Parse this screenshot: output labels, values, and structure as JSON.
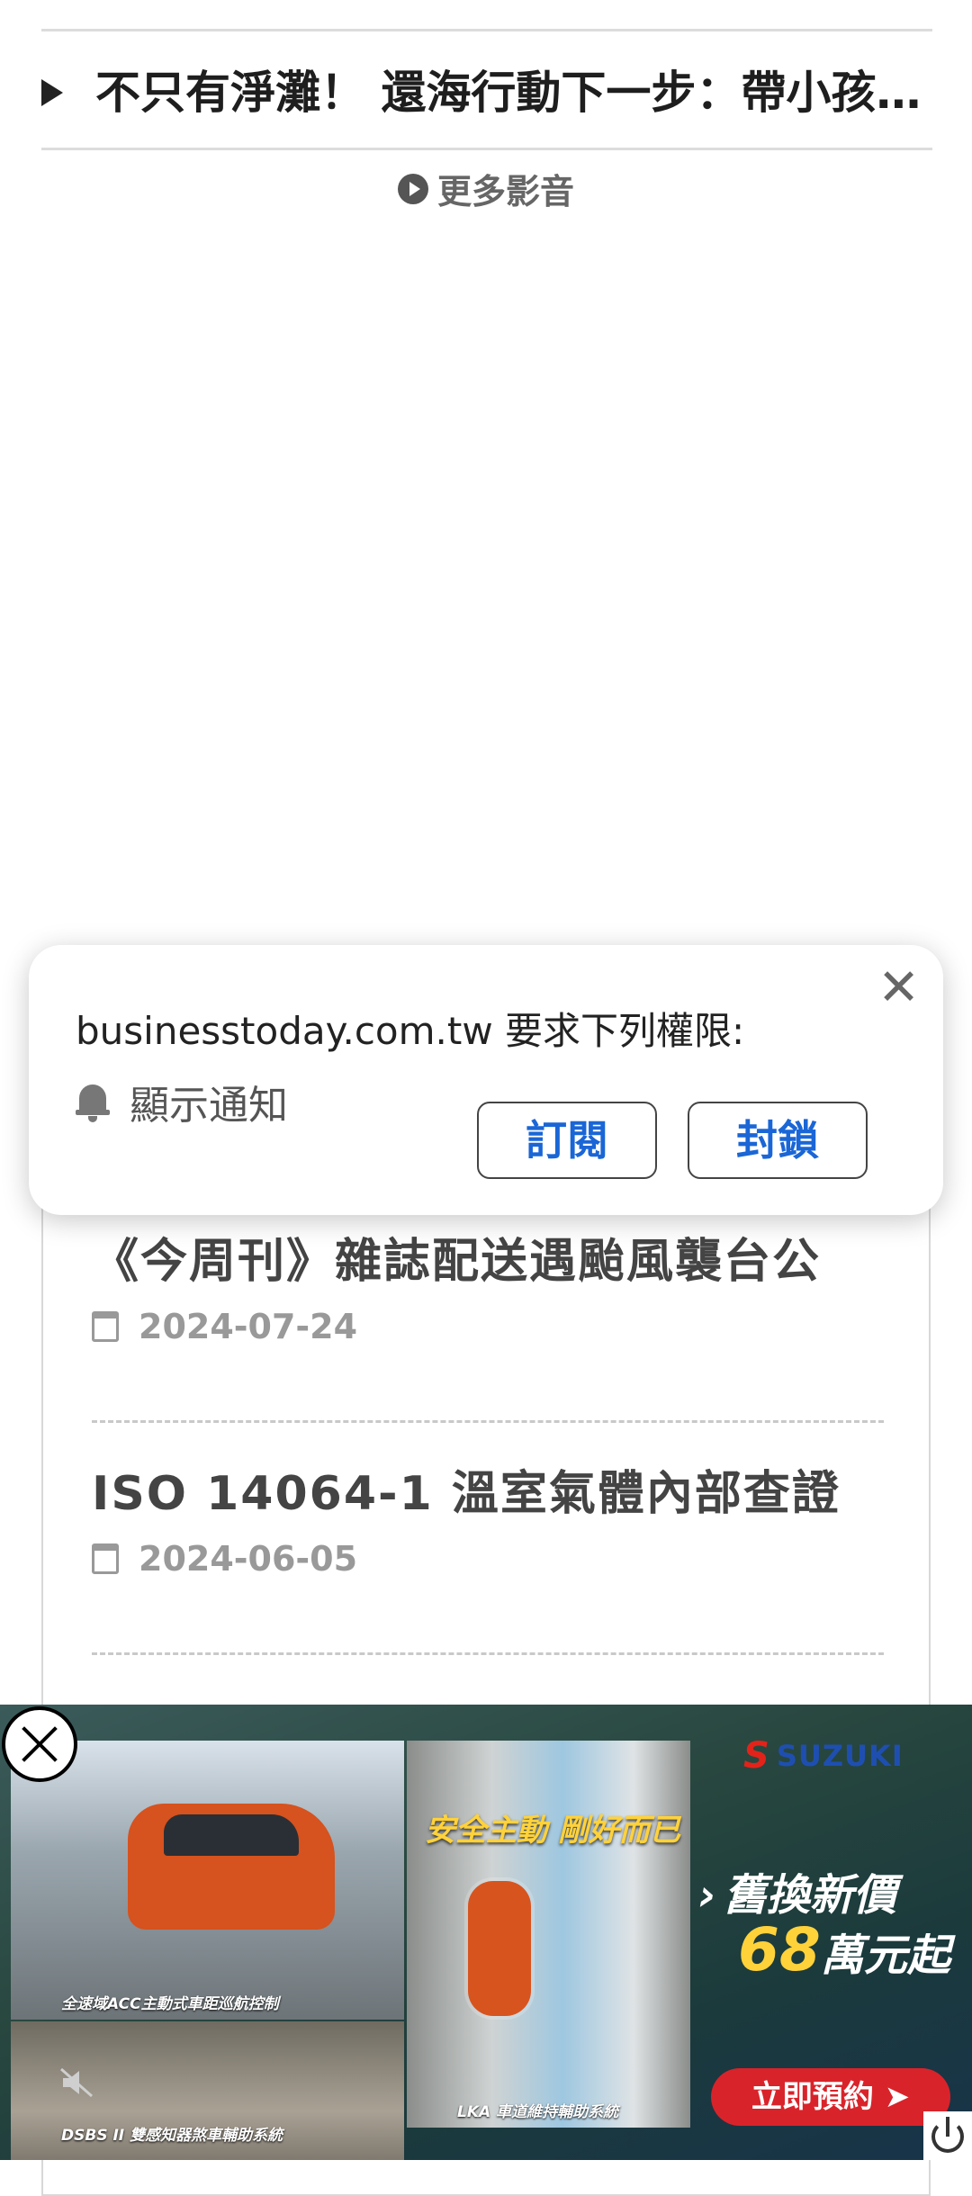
{
  "video_list": {
    "items": [
      {
        "title": "不只有淨灘！ 還海行動下一步：帶小孩的海洋教育"
      }
    ],
    "more_label": "更多影音"
  },
  "permission_prompt": {
    "title": "businesstoday.com.tw 要求下列權限:",
    "permission_label": "顯示通知",
    "subscribe_label": "訂閱",
    "block_label": "封鎖",
    "close_icon": "close-icon",
    "bell_icon": "bell-icon"
  },
  "news": {
    "items": [
      {
        "title": "《今周刊》雜誌配送遇颱風襲台公",
        "date": "2024-07-24"
      },
      {
        "title": "ISO 14064-1 溫室氣體內部查證",
        "date": "2024-06-05"
      }
    ]
  },
  "ad": {
    "brand": "SUZUKI",
    "slogan": "安全主動 剛好而已",
    "caption_acc": "全速域ACC主動式車距巡航控制",
    "caption_dsbs": "DSBS II 雙感知器煞車輔助系統",
    "caption_lka": "LKA 車道維持輔助系統",
    "offer_line1": "舊換新價",
    "offer_number": "68",
    "offer_unit": "萬元起",
    "cta_label": "立即預約 ➤",
    "colors": {
      "cta": "#d9232a",
      "highlight": "#ffd23a",
      "brand_blue": "#1e4fb0",
      "brand_red": "#e2231a"
    }
  },
  "colors": {
    "link_blue": "#1a66d6",
    "date_gray": "#999999"
  }
}
